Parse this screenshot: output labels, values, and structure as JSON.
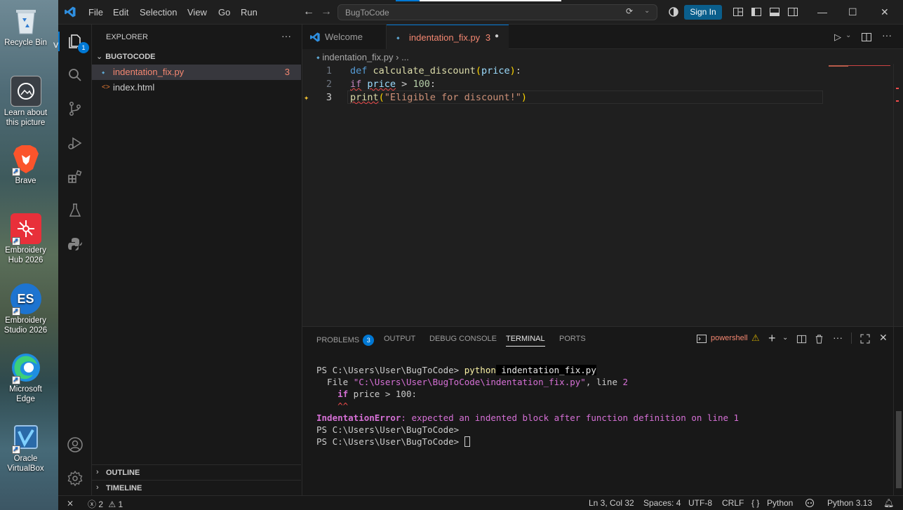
{
  "desktop": {
    "icons": [
      {
        "label": "Recycle Bin",
        "icon": "recycle-bin-icon"
      },
      {
        "label": "Learn about this picture",
        "icon": "camera-icon"
      },
      {
        "label": "Brave",
        "icon": "brave-lion-icon"
      },
      {
        "label": "Embroidery Hub 2026",
        "icon": "embroidery-hub-icon"
      },
      {
        "label": "Embroidery Studio 2026",
        "icon": "es-icon"
      },
      {
        "label": "Microsoft Edge",
        "icon": "edge-icon"
      },
      {
        "label": "Oracle VirtualBox",
        "icon": "virtualbox-icon"
      }
    ],
    "icon_text": {
      "es": "ES",
      "cut": "V"
    }
  },
  "titlebar": {
    "menus": [
      "File",
      "Edit",
      "Selection",
      "View",
      "Go",
      "Run"
    ],
    "search": "BugToCode",
    "sign_in": "Sign In"
  },
  "activity": {
    "explorer_badge": "1"
  },
  "sidebar": {
    "title": "EXPLORER",
    "more": "···",
    "folder": "BUGTOCODE",
    "files": [
      {
        "name": "indentation_fix.py",
        "count": "3",
        "icon": "python-file-icon"
      },
      {
        "name": "index.html",
        "icon": "html-file-icon"
      }
    ],
    "html_glyph": "<>",
    "outline": "OUTLINE",
    "timeline": "TIMELINE"
  },
  "editor": {
    "tabs": [
      {
        "label": "Welcome"
      },
      {
        "label": "indentation_fix.py",
        "count": "3"
      }
    ],
    "breadcrumb": {
      "file": "indentation_fix.py",
      "rest": "›  ..."
    },
    "code": {
      "line_numbers": [
        "1",
        "2",
        "3"
      ],
      "l1": {
        "kw": "def",
        "fn": "calculate_discount",
        "open": "(",
        "param": "price",
        "close": ")",
        "colon": ":"
      },
      "l2": {
        "kw": "if",
        "var": "price",
        "op": " > ",
        "num": "100",
        "colon": ":"
      },
      "l3": {
        "fn": "print",
        "open": "(",
        "str": "\"Eligible for discount!\"",
        "close": ")"
      }
    }
  },
  "panel": {
    "tabs": [
      "PROBLEMS",
      "OUTPUT",
      "DEBUG CONSOLE",
      "TERMINAL",
      "PORTS"
    ],
    "problems_count": "3",
    "active_tab": "TERMINAL",
    "shell": "powershell",
    "terminal": {
      "l1": {
        "prompt": "PS C:\\Users\\User\\BugToCode> ",
        "cmd": "python",
        "arg": " indentation_fix.py"
      },
      "l2": {
        "a": "  File ",
        "path": "\"C:\\Users\\User\\BugToCode\\indentation_fix.py\"",
        "b": ", line ",
        "num": "2"
      },
      "l3": {
        "kw": "    if",
        "rest": " price > 100:"
      },
      "l4": "    ^^",
      "l5": {
        "err": "IndentationError",
        "msg": ": expected an indented block after function definition on line 1"
      },
      "l6": "PS C:\\Users\\User\\BugToCode>",
      "l7": "PS C:\\Users\\User\\BugToCode> "
    }
  },
  "status": {
    "errors": "2",
    "warnings": "1",
    "position": "Ln 3, Col 32",
    "spaces": "Spaces: 4",
    "encoding": "UTF-8",
    "eol": "CRLF",
    "braces": "{ }",
    "language": "Python",
    "interpreter": "Python 3.13"
  },
  "colors": {
    "accent": "#0078d4",
    "error": "#f14c4c",
    "signin": "#0a5e8c"
  }
}
